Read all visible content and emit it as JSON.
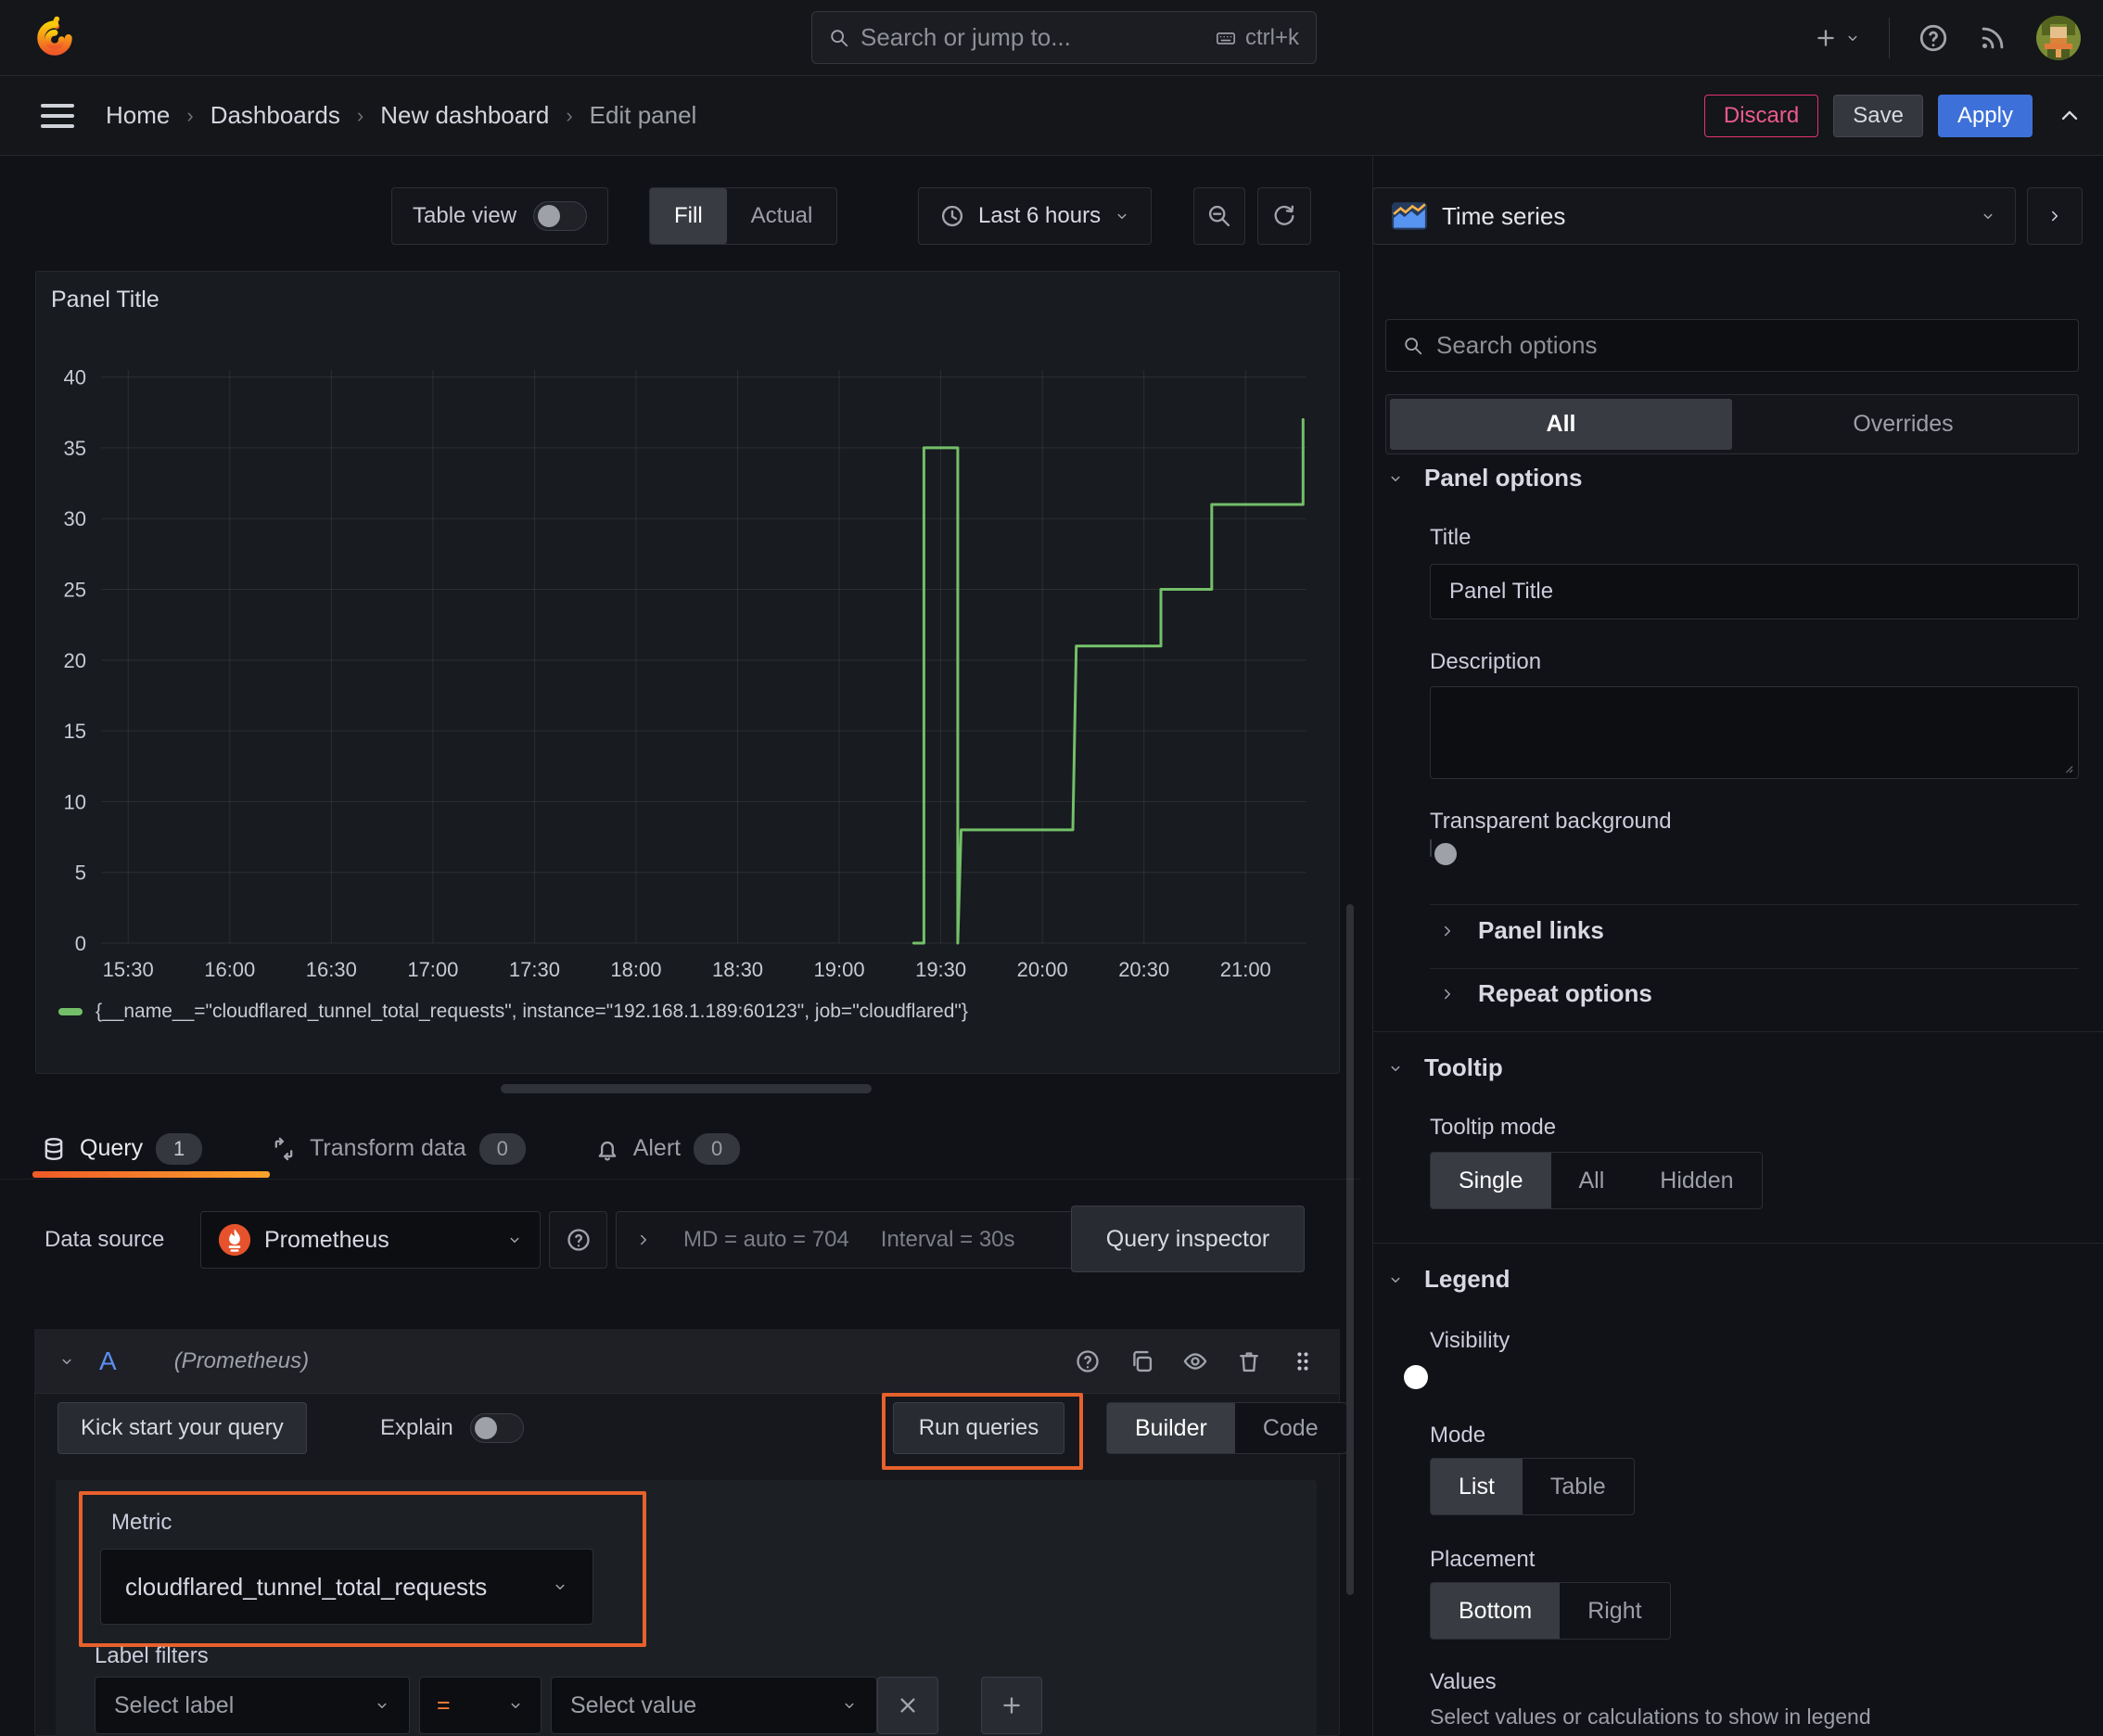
{
  "topbar": {
    "search_placeholder": "Search or jump to...",
    "shortcut": "ctrl+k"
  },
  "breadcrumb": {
    "items": [
      "Home",
      "Dashboards",
      "New dashboard",
      "Edit panel"
    ]
  },
  "actions": {
    "discard": "Discard",
    "save": "Save",
    "apply": "Apply"
  },
  "toolbar": {
    "table_view": "Table view",
    "fill": "Fill",
    "actual": "Actual",
    "time_range": "Last 6 hours"
  },
  "viz_picker": {
    "label": "Time series"
  },
  "sidebar": {
    "search_placeholder": "Search options",
    "tabs": {
      "all": "All",
      "overrides": "Overrides"
    },
    "panel_options": {
      "heading": "Panel options",
      "title_label": "Title",
      "title_value": "Panel Title",
      "description_label": "Description",
      "transparent_label": "Transparent background"
    },
    "panel_links": "Panel links",
    "repeat_options": "Repeat options",
    "tooltip": {
      "heading": "Tooltip",
      "mode_label": "Tooltip mode",
      "options": [
        "Single",
        "All",
        "Hidden"
      ],
      "selected": "Single"
    },
    "legend": {
      "heading": "Legend",
      "visibility_label": "Visibility",
      "mode_label": "Mode",
      "mode_options": [
        "List",
        "Table"
      ],
      "mode_selected": "List",
      "placement_label": "Placement",
      "placement_options": [
        "Bottom",
        "Right"
      ],
      "placement_selected": "Bottom",
      "values_label": "Values",
      "values_hint": "Select values or calculations to show in legend"
    }
  },
  "tabs": {
    "query_label": "Query",
    "query_count": "1",
    "transform_label": "Transform data",
    "transform_count": "0",
    "alert_label": "Alert",
    "alert_count": "0"
  },
  "datasource": {
    "label": "Data source",
    "name": "Prometheus",
    "md_stat": "MD = auto = 704",
    "interval_stat": "Interval = 30s",
    "inspector": "Query inspector"
  },
  "query": {
    "ref_id": "A",
    "ds_hint": "(Prometheus)",
    "kick_start": "Kick start your query",
    "explain_label": "Explain",
    "run_label": "Run queries",
    "builder_label": "Builder",
    "code_label": "Code",
    "metric_label": "Metric",
    "metric_value": "cloudflared_tunnel_total_requests",
    "label_filters_label": "Label filters",
    "select_label_placeholder": "Select label",
    "operator": "=",
    "select_value_placeholder": "Select value"
  },
  "chart_data": {
    "type": "line",
    "title": "Panel Title",
    "xlabel": "",
    "ylabel": "",
    "x_tick_labels": [
      "15:30",
      "16:00",
      "16:30",
      "17:00",
      "17:30",
      "18:00",
      "18:30",
      "19:00",
      "19:30",
      "20:00",
      "20:30",
      "21:00"
    ],
    "x_tick_minutes": [
      0,
      30,
      60,
      90,
      120,
      150,
      180,
      210,
      240,
      270,
      300,
      330
    ],
    "x_domain_minutes_from_1530": [
      -8,
      348
    ],
    "y_ticks": [
      0,
      5,
      10,
      15,
      20,
      25,
      30,
      35,
      40
    ],
    "ylim": [
      0,
      40.5
    ],
    "grid": true,
    "legend_position": "bottom",
    "series": [
      {
        "name": "{__name__=\"cloudflared_tunnel_total_requests\", instance=\"192.168.1.189:60123\", job=\"cloudflared\"}",
        "color": "#73bf69",
        "points_minutes_value": [
          [
            232,
            0
          ],
          [
            235,
            0
          ],
          [
            235,
            35
          ],
          [
            245,
            35
          ],
          [
            245,
            0
          ],
          [
            246,
            8
          ],
          [
            279,
            8
          ],
          [
            280,
            21
          ],
          [
            305,
            21
          ],
          [
            305,
            25
          ],
          [
            320,
            25
          ],
          [
            320,
            31
          ],
          [
            347,
            31
          ],
          [
            347,
            37
          ]
        ]
      }
    ]
  }
}
